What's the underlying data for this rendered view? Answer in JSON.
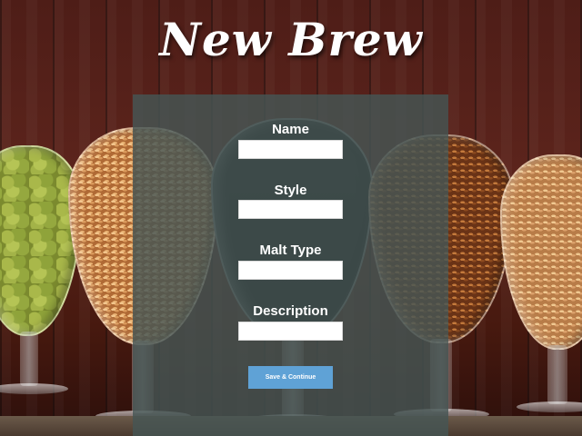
{
  "page": {
    "title": "New Brew"
  },
  "form": {
    "fields": [
      {
        "label": "Name",
        "value": "",
        "placeholder": ""
      },
      {
        "label": "Style",
        "value": "",
        "placeholder": ""
      },
      {
        "label": "Malt Type",
        "value": "",
        "placeholder": ""
      },
      {
        "label": "Description",
        "value": "",
        "placeholder": ""
      }
    ],
    "submit_label": "Save & Continue"
  },
  "colors": {
    "panel_overlay": "#465654",
    "button": "#5fa2d6",
    "title": "#ffffff"
  },
  "background": {
    "subject": "beer glasses filled with hops and malt grains on a wooden wall"
  }
}
